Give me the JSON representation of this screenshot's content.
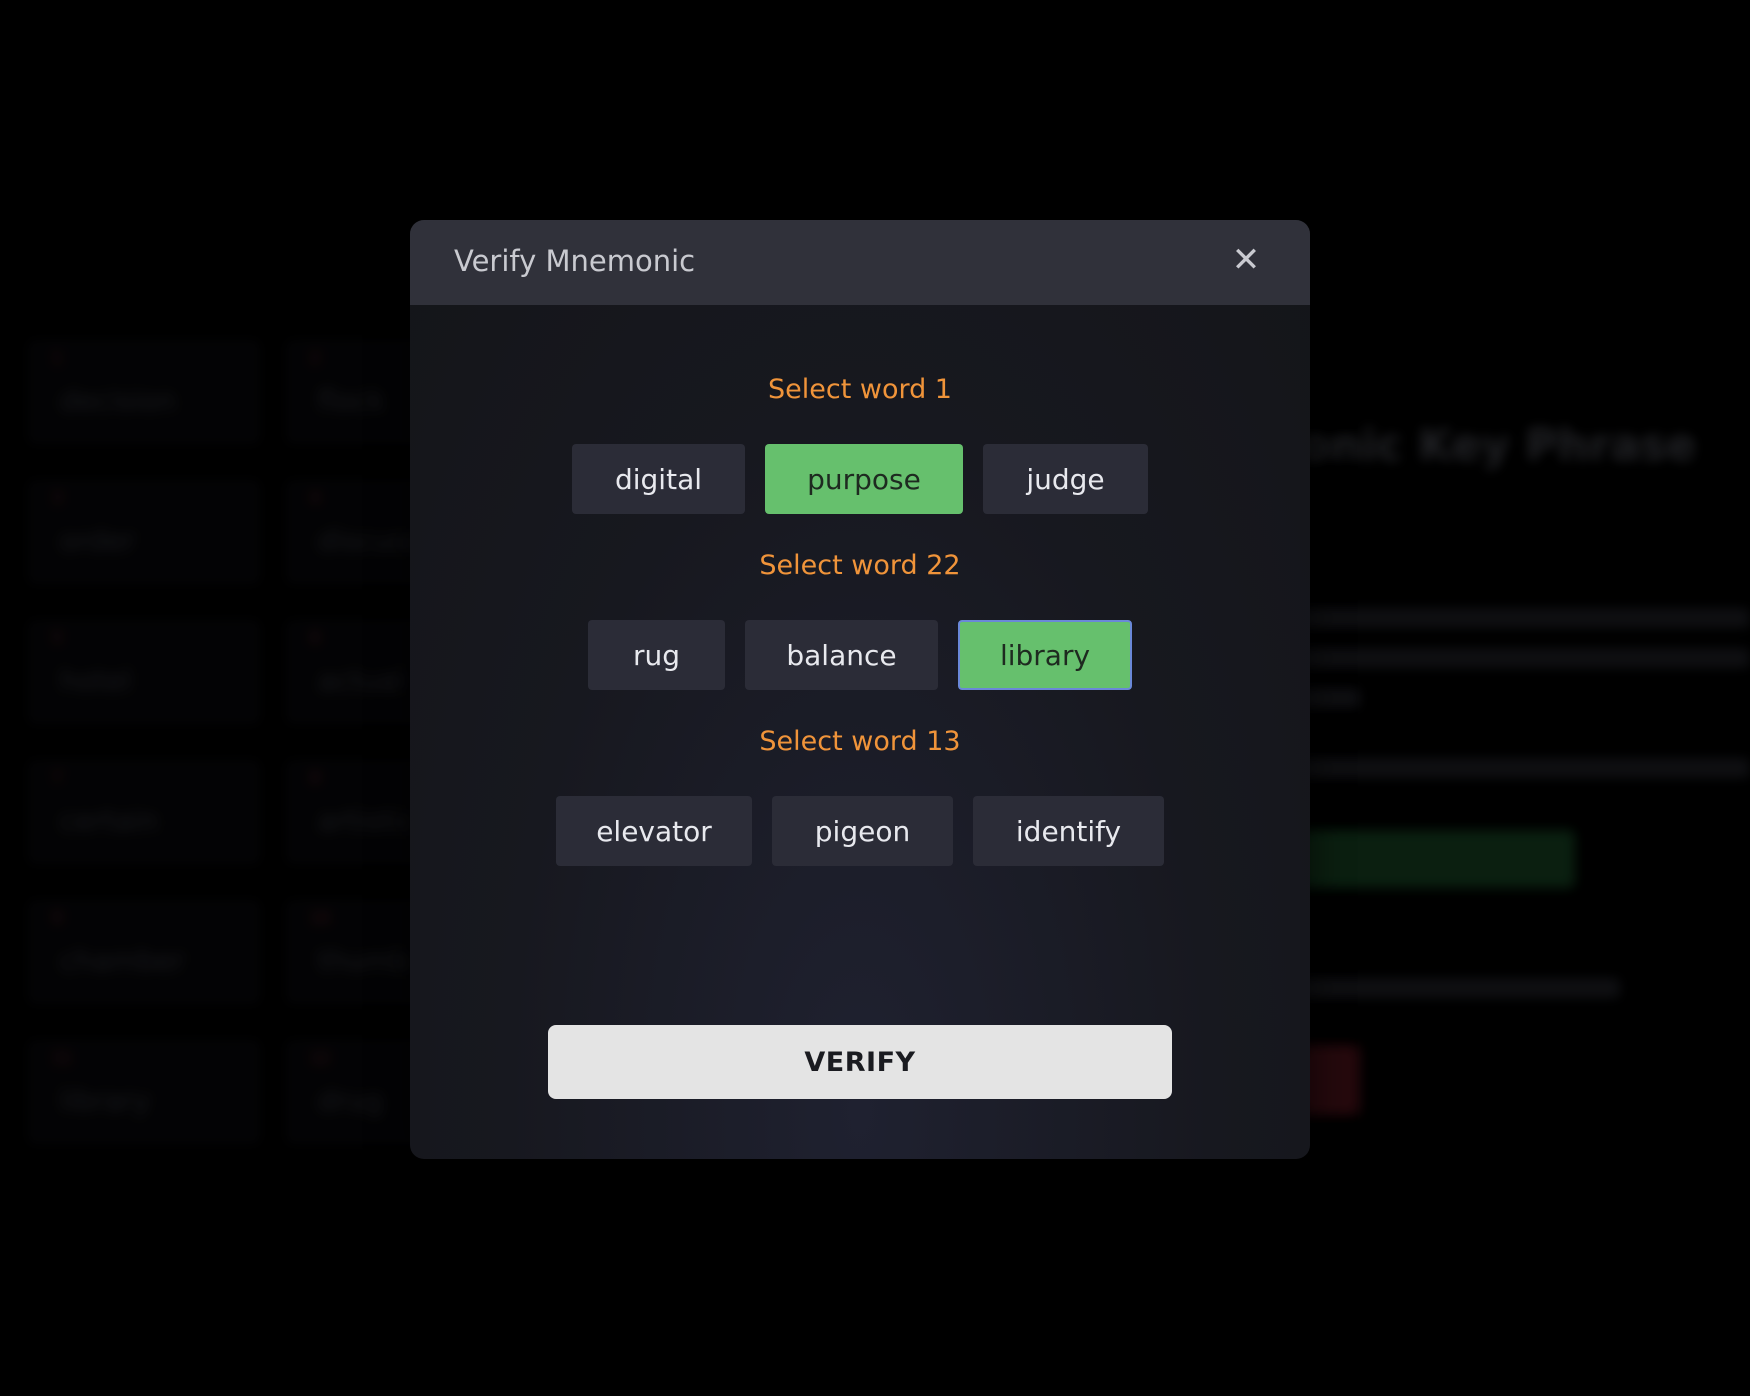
{
  "background": {
    "page_heading": "onic Key Phrase",
    "words": [
      {
        "num": "1",
        "word": "decision"
      },
      {
        "num": "2",
        "word": "flock"
      },
      {
        "num": "3",
        "word": "order"
      },
      {
        "num": "4",
        "word": "discuss"
      },
      {
        "num": "5",
        "word": "hotel"
      },
      {
        "num": "6",
        "word": "actual"
      },
      {
        "num": "7",
        "word": "certain"
      },
      {
        "num": "8",
        "word": "artistic"
      },
      {
        "num": "9",
        "word": "chamber"
      },
      {
        "num": "10",
        "word": "thumb"
      },
      {
        "num": "11",
        "word": "library"
      },
      {
        "num": "12",
        "word": "drug"
      }
    ]
  },
  "modal": {
    "title": "Verify Mnemonic",
    "close_icon": "close-icon",
    "groups": [
      {
        "label": "Select word 1",
        "options": [
          "digital",
          "purpose",
          "judge"
        ],
        "selected": "purpose"
      },
      {
        "label": "Select word 22",
        "options": [
          "rug",
          "balance",
          "library"
        ],
        "selected": "library"
      },
      {
        "label": "Select word 13",
        "options": [
          "elevator",
          "pigeon",
          "identify"
        ],
        "selected": null
      }
    ],
    "verify_label": "VERIFY"
  },
  "colors": {
    "accent_label": "#f0943a",
    "selected": "#66c06d",
    "focus_ring": "#6a88d8"
  }
}
